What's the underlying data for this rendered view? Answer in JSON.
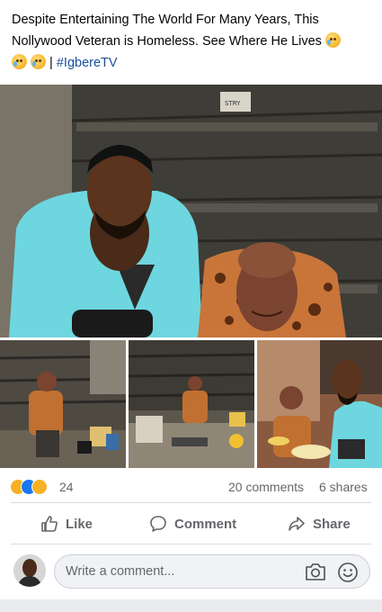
{
  "post": {
    "text": "Despite Entertaining The World For Many Years, This Nollywood Veteran is Homeless. See Where He Lives",
    "separator": " | ",
    "hashtag": "#IgbereTV"
  },
  "photos": {
    "main_sign": "STRY"
  },
  "stats": {
    "reactions_count": "24",
    "comments": "20 comments",
    "shares": "6 shares"
  },
  "actions": {
    "like": "Like",
    "comment": "Comment",
    "share": "Share"
  },
  "composer": {
    "placeholder": "Write a comment..."
  },
  "colors": {
    "accent": "#1877f2",
    "muted": "#65676b",
    "hashtag": "#1a4f9c"
  }
}
